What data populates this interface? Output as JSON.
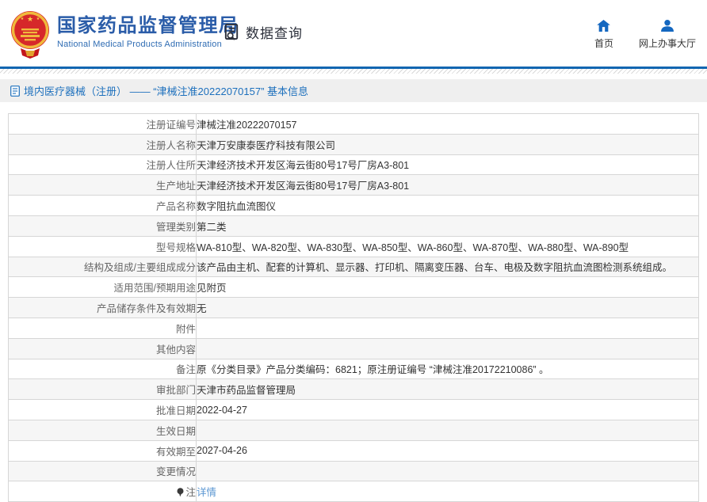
{
  "header": {
    "org_name_zh": "国家药品监督管理局",
    "org_name_en": "National Medical Products Administration",
    "data_query_label": "数据查询",
    "home_label": "首页",
    "service_hall_label": "网上办事大厅"
  },
  "icons": {
    "emblem": "china-national-emblem",
    "data_query": "document-search-icon",
    "home": "home-icon",
    "service_hall": "person-icon",
    "breadcrumb": "document-icon",
    "note": "balloon-icon"
  },
  "colors": {
    "brand_blue": "#2a5ca8",
    "rule_blue": "#1266b1",
    "icon_blue": "#1467c0",
    "breadcrumb_text_blue": "#1d70bd",
    "link_blue": "#5a96d2",
    "breadcrumb_bg": "#efefef",
    "stripe_bg": "#f6f6f6",
    "border_gray": "#d6d6d6"
  },
  "breadcrumb": {
    "text": "境内医疗器械（注册） —— “津械注准20222070157” 基本信息"
  },
  "table": {
    "rows": [
      {
        "label": "注册证编号",
        "value": "津械注准20222070157"
      },
      {
        "label": "注册人名称",
        "value": "天津万安康泰医疗科技有限公司"
      },
      {
        "label": "注册人住所",
        "value": "天津经济技术开发区海云街80号17号厂房A3-801"
      },
      {
        "label": "生产地址",
        "value": "天津经济技术开发区海云街80号17号厂房A3-801"
      },
      {
        "label": "产品名称",
        "value": "数字阻抗血流图仪"
      },
      {
        "label": "管理类别",
        "value": "第二类"
      },
      {
        "label": "型号规格",
        "value": "WA-810型、WA-820型、WA-830型、WA-850型、WA-860型、WA-870型、WA-880型、WA-890型"
      },
      {
        "label": "结构及组成/主要组成成分",
        "value": "该产品由主机、配套的计算机、显示器、打印机、隔离变压器、台车、电极及数字阻抗血流图检测系统组成。"
      },
      {
        "label": "适用范围/预期用途",
        "value": "见附页"
      },
      {
        "label": "产品储存条件及有效期",
        "value": "无"
      },
      {
        "label": "附件",
        "value": ""
      },
      {
        "label": "其他内容",
        "value": ""
      },
      {
        "label": "备注",
        "value": "原《分类目录》产品分类编码：6821；原注册证编号 “津械注准20172210086” 。"
      },
      {
        "label": "审批部门",
        "value": "天津市药品监督管理局"
      },
      {
        "label": "批准日期",
        "value": "2022-04-27"
      },
      {
        "label": "生效日期",
        "value": ""
      },
      {
        "label": "有效期至",
        "value": "2027-04-26"
      },
      {
        "label": "变更情况",
        "value": ""
      },
      {
        "label": "注",
        "value": "详情"
      }
    ]
  }
}
